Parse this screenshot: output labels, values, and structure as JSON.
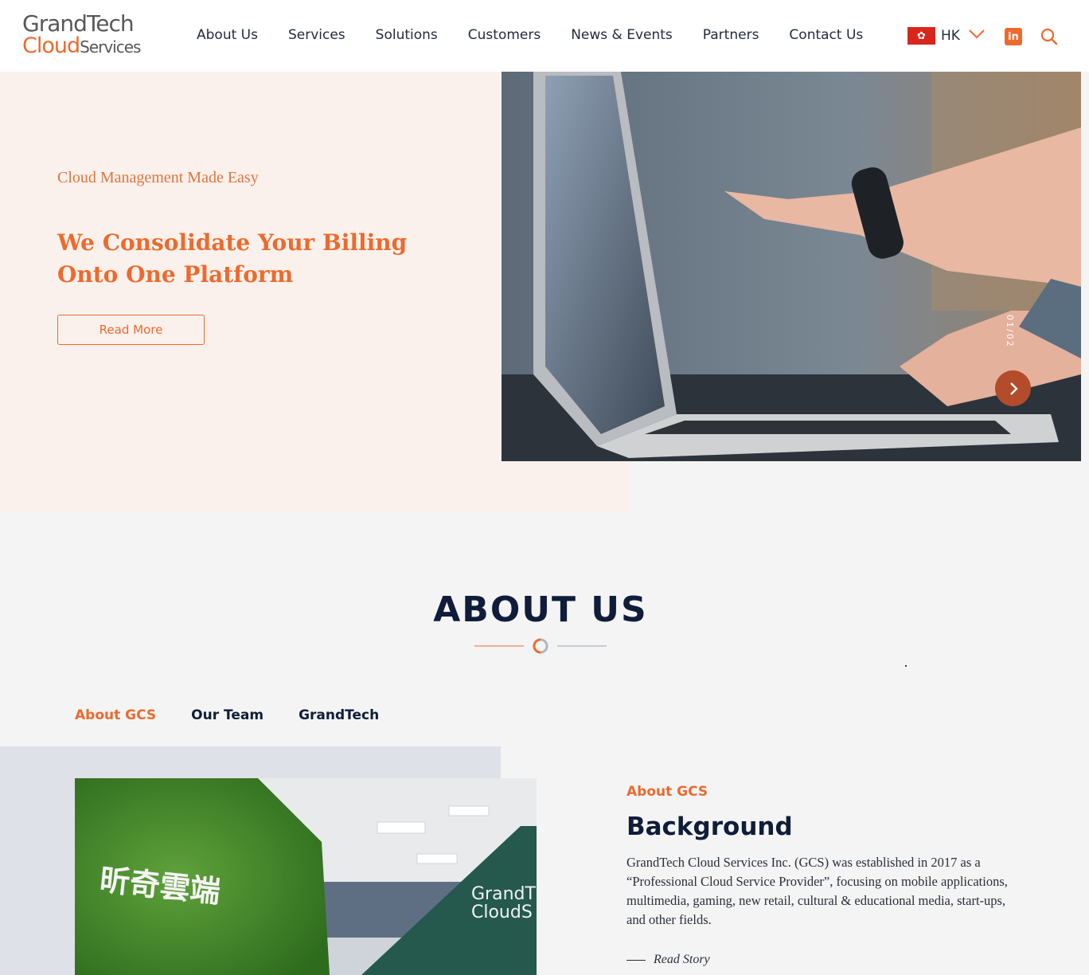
{
  "brand": {
    "logo_line1": "GrandTech",
    "logo_cloud": "Cloud",
    "logo_services": "Services",
    "accent_color": "#ec6a2e",
    "navy_color": "#0f1d3a"
  },
  "nav": {
    "items": [
      {
        "label": "About Us"
      },
      {
        "label": "Services"
      },
      {
        "label": "Solutions"
      },
      {
        "label": "Customers"
      },
      {
        "label": "News & Events"
      },
      {
        "label": "Partners"
      },
      {
        "label": "Contact Us"
      }
    ]
  },
  "region": {
    "label": "HK",
    "flag_icon": "hk-flag-icon"
  },
  "icons": {
    "linkedin": "in",
    "search": "search-icon"
  },
  "hero": {
    "subtitle": "Cloud Management Made Easy",
    "title": "We Consolidate Your Billing Onto One Platform",
    "button_label": "Read More",
    "slide_counter": "01/02"
  },
  "about": {
    "title": "ABOUT US",
    "tabs": [
      {
        "label": "About GCS",
        "active": true
      },
      {
        "label": "Our Team",
        "active": false
      },
      {
        "label": "GrandTech",
        "active": false
      }
    ],
    "label": "About GCS",
    "heading": "Background",
    "body": "GrandTech Cloud Services Inc. (GCS) was established in 2017 as a “Professional Cloud Service Provider”, focusing on mobile applications, multimedia, gaming, new retail, cultural & educational media, start-ups, and other fields.",
    "read_story": "Read Story",
    "wall_sign": "昕奇雲端",
    "wall_logo_1": "GrandT",
    "wall_logo_2": "CloudS"
  }
}
